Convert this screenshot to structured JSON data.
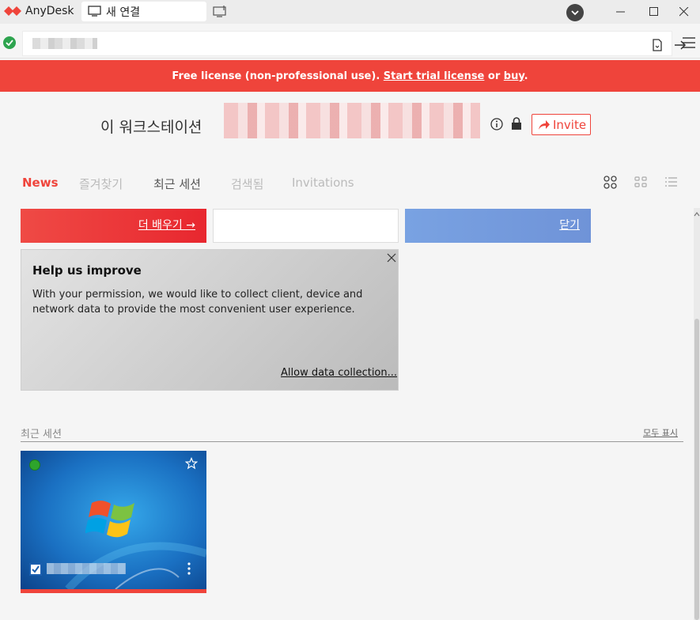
{
  "app": {
    "name": "AnyDesk",
    "tab_label": "새 연결"
  },
  "banner": {
    "prefix": "Free license (non-professional use). ",
    "trial_link": "Start trial license",
    "middle": " or ",
    "buy_link": "buy",
    "suffix": ".",
    "color": "#ef443b"
  },
  "workstation": {
    "label": "이 워크스테이션",
    "invite_label": "Invite"
  },
  "nav": {
    "tabs": [
      "News",
      "즐겨찾기",
      "최근 세션",
      "검색됨",
      "Invitations"
    ],
    "active": "News"
  },
  "news": {
    "learn_more": "더 배우기 →",
    "close": "닫기"
  },
  "help": {
    "title": "Help us improve",
    "text": "With your permission, we would like to collect client, device and network data to provide the most convenient user experience.",
    "link": "Allow data collection..."
  },
  "recent": {
    "title": "최근 세션",
    "show_all": "모두 표시"
  },
  "colors": {
    "accent": "#ef443b",
    "online": "#2ea42c",
    "blue_card": "#6f93d8"
  }
}
